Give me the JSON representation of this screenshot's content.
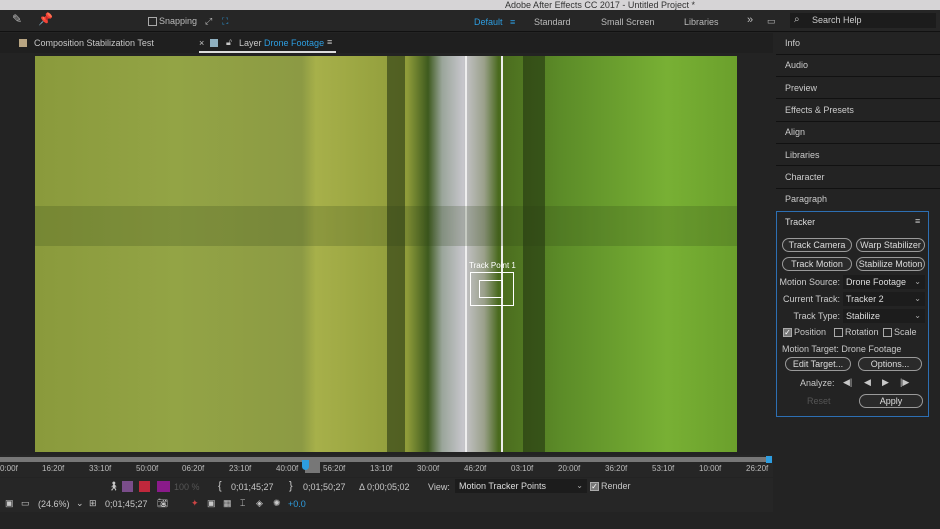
{
  "app": {
    "title": "Adobe After Effects CC 2017 - Untitled Project *"
  },
  "toolbar": {
    "snapping": "Snapping",
    "workspaces": [
      "Default",
      "Standard",
      "Small Screen",
      "Libraries"
    ],
    "search_placeholder": "Search Help",
    "more": "»"
  },
  "tabs": [
    {
      "label": "Composition Stabilization Test"
    },
    {
      "prefix": "Layer",
      "label": "Drone Footage"
    }
  ],
  "viewer": {
    "track_point": "Track Point 1"
  },
  "timeline": {
    "ticks": [
      "0:00f",
      "16:20f",
      "33:10f",
      "50:00f",
      "06:20f",
      "23:10f",
      "40:00f",
      "56:20f",
      "13:10f",
      "30:00f",
      "46:20f",
      "03:10f",
      "20:00f",
      "36:20f",
      "53:10f",
      "10:00f",
      "26:20f"
    ]
  },
  "controls": {
    "zoom_pct": "100 %",
    "in_point": "0;01;45;27",
    "out_point": "0;01;50;27",
    "duration": "Δ 0;00;05;02",
    "view_label": "View:",
    "view_value": "Motion Tracker Points",
    "render": "Render",
    "magnification": "(24.6%)",
    "current_time": "0;01;45;27",
    "exposure": "+0.0"
  },
  "panels": [
    "Info",
    "Audio",
    "Preview",
    "Effects & Presets",
    "Align",
    "Libraries",
    "Character",
    "Paragraph"
  ],
  "tracker": {
    "title": "Tracker",
    "track_camera": "Track Camera",
    "warp_stabilizer": "Warp Stabilizer",
    "track_motion": "Track Motion",
    "stabilize_motion": "Stabilize Motion",
    "motion_source_label": "Motion Source:",
    "motion_source": "Drone Footage",
    "current_track_label": "Current Track:",
    "current_track": "Tracker 2",
    "track_type_label": "Track Type:",
    "track_type": "Stabilize",
    "position": "Position",
    "rotation": "Rotation",
    "scale": "Scale",
    "position_checked": true,
    "motion_target": "Motion Target: Drone Footage",
    "edit_target": "Edit Target...",
    "options": "Options...",
    "analyze": "Analyze:",
    "reset": "Reset",
    "apply": "Apply"
  },
  "colors": {
    "accent": "#2d9de0",
    "panel_border": "#2d6fb3"
  }
}
